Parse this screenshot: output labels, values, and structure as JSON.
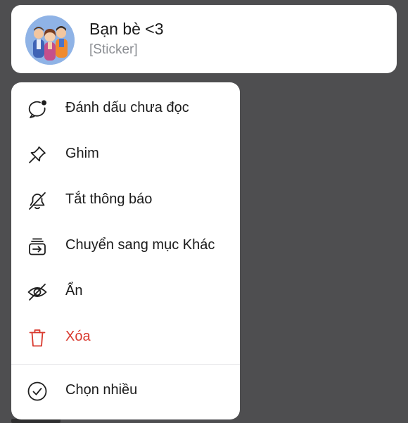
{
  "chat": {
    "name": "Bạn bè <3",
    "preview": "[Sticker]"
  },
  "menu": {
    "items": [
      {
        "label": "Đánh dấu chưa đọc",
        "icon": "unread-bubble-icon"
      },
      {
        "label": "Ghim",
        "icon": "pin-icon"
      },
      {
        "label": "Tắt thông báo",
        "icon": "bell-off-icon"
      },
      {
        "label": "Chuyển sang mục Khác",
        "icon": "move-to-other-icon"
      },
      {
        "label": "Ẩn",
        "icon": "eye-off-icon"
      },
      {
        "label": "Xóa",
        "icon": "trash-icon"
      }
    ],
    "footer_item": {
      "label": "Chọn nhiều",
      "icon": "check-circle-icon"
    }
  },
  "colors": {
    "backdrop": "#4e4e50",
    "card": "#ffffff",
    "text": "#1b1b1b",
    "muted": "#8a8d92",
    "danger": "#d93a2f",
    "icon_stroke": "#1f1f1f"
  }
}
